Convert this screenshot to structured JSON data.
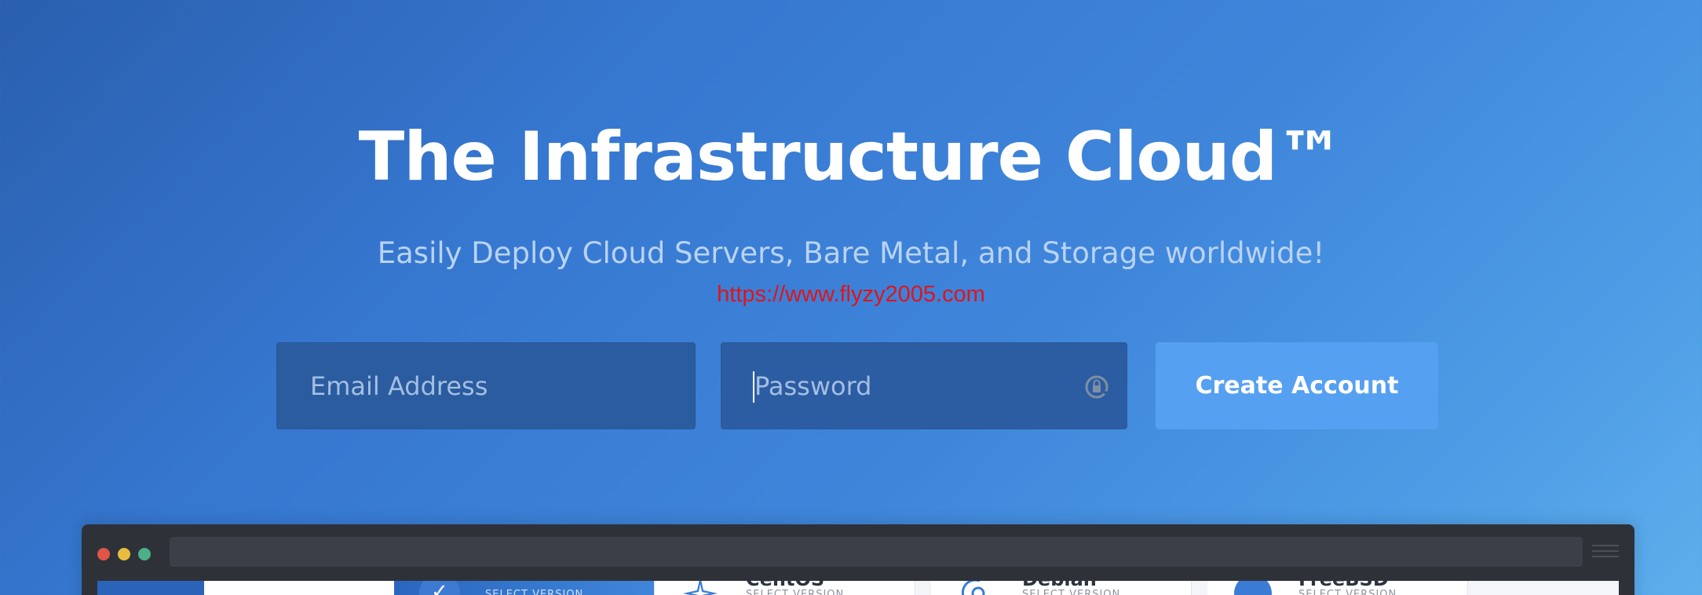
{
  "hero": {
    "title": "The Infrastructure Cloud™",
    "subtitle": "Easily Deploy Cloud Servers, Bare Metal, and Storage worldwide!",
    "watermark": "https://www.flyzy2005.com"
  },
  "signup": {
    "email_placeholder": "Email Address",
    "password_placeholder": "Password",
    "submit_label": "Create Account"
  },
  "preview": {
    "cards": [
      {
        "name": "",
        "sub": "SELECT VERSION",
        "selected": true,
        "icon": "check-icon"
      },
      {
        "name": "CentOS",
        "sub": "SELECT VERSION",
        "selected": false,
        "icon": "centos-icon"
      },
      {
        "name": "Debian",
        "sub": "SELECT VERSION",
        "selected": false,
        "icon": "debian-icon"
      },
      {
        "name": "FreeBSD",
        "sub": "SELECT VERSION",
        "selected": false,
        "icon": "freebsd-icon"
      }
    ]
  },
  "colors": {
    "background_start": "#2a5fae",
    "background_end": "#5eaeec",
    "button": "#56a0f2",
    "input": "#2b5c9f",
    "watermark": "#e0141b"
  }
}
